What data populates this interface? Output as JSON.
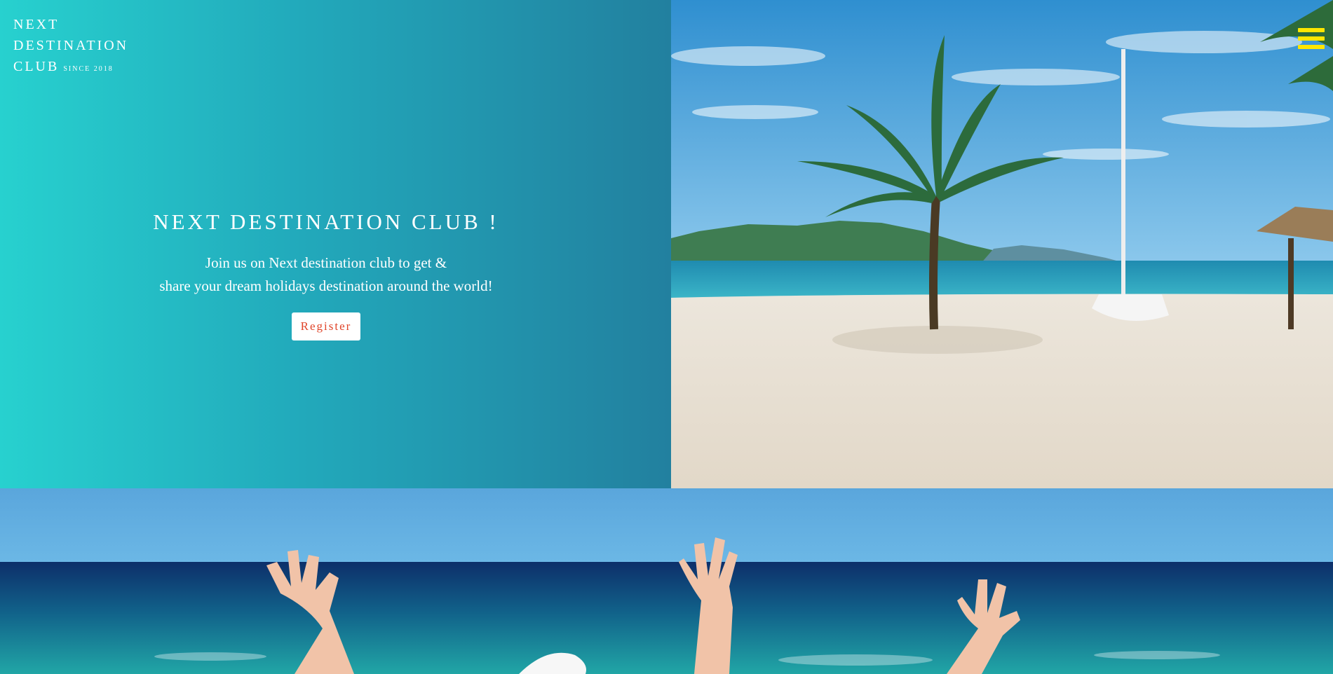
{
  "logo": {
    "line1": "NEXT",
    "line2": "DESTINATION",
    "line3": "CLUB",
    "since": "SINCE 2018"
  },
  "hero": {
    "title": "NEXT DESTINATION CLUB !",
    "text_line1": "Join us on Next destination club to get &",
    "text_line2": "share your dream holidays destination around the world!",
    "register_label": "Register"
  },
  "nav": {
    "menu_icon": "hamburger-menu-icon"
  },
  "images": {
    "beach": "beach-with-palm-tree-photo",
    "ocean": "raised-hands-ocean-photo"
  },
  "colors": {
    "gradient_start": "#27d1cf",
    "gradient_end": "#22809f",
    "register_text": "#e0452a",
    "menu_icon": "#ffe600"
  }
}
